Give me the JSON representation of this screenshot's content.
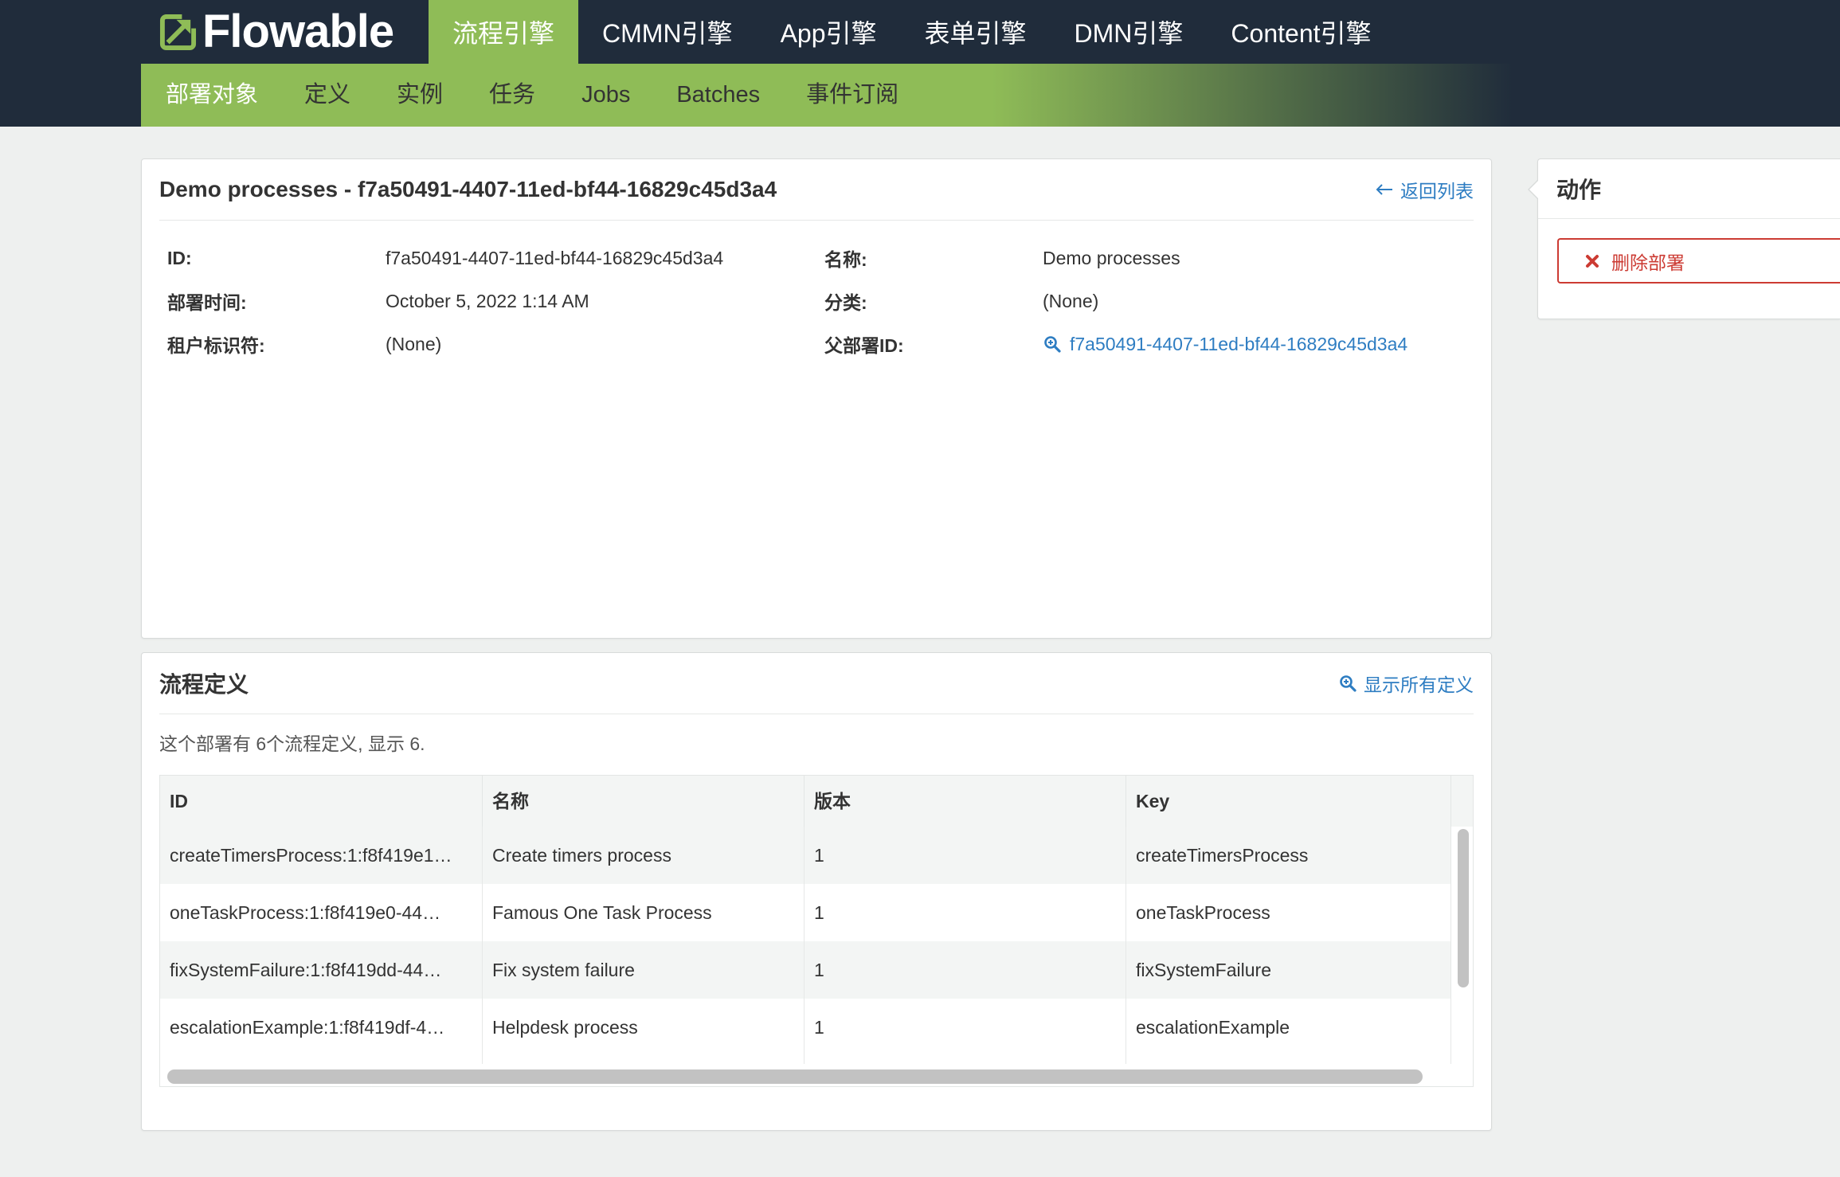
{
  "theme": {
    "nav_background": "#202c3b",
    "brand_green": "#8fbc57",
    "link_blue": "#2e7dc2",
    "danger_red": "#cc3b33",
    "page_background": "#eef0ef"
  },
  "app": {
    "logo_text": "Flowable",
    "logo_icon": "flowable-logo-icon"
  },
  "top_nav": {
    "tabs": [
      {
        "label": "流程引擎",
        "active": true
      },
      {
        "label": "CMMN引擎",
        "active": false
      },
      {
        "label": "App引擎",
        "active": false
      },
      {
        "label": "表单引擎",
        "active": false
      },
      {
        "label": "DMN引擎",
        "active": false
      },
      {
        "label": "Content引擎",
        "active": false
      }
    ]
  },
  "sub_nav": {
    "items": [
      {
        "label": "部署对象",
        "active": true
      },
      {
        "label": "定义",
        "active": false
      },
      {
        "label": "实例",
        "active": false
      },
      {
        "label": "任务",
        "active": false
      },
      {
        "label": "Jobs",
        "active": false
      },
      {
        "label": "Batches",
        "active": false
      },
      {
        "label": "事件订阅",
        "active": false
      }
    ]
  },
  "deployment": {
    "title": "Demo processes - f7a50491-4407-11ed-bf44-16829c45d3a4",
    "back_link": {
      "label": "返回列表",
      "icon": "arrow-left-icon"
    },
    "fields": {
      "id": {
        "label": "ID:",
        "value": "f7a50491-4407-11ed-bf44-16829c45d3a4"
      },
      "name": {
        "label": "名称:",
        "value": "Demo processes"
      },
      "deploy_time": {
        "label": "部署时间:",
        "value": "October 5, 2022 1:14 AM"
      },
      "category": {
        "label": "分类:",
        "value": "(None)"
      },
      "tenant_id": {
        "label": "租户标识符:",
        "value": "(None)"
      },
      "parent_deployment_id": {
        "label": "父部署ID:",
        "value": "f7a50491-4407-11ed-bf44-16829c45d3a4",
        "icon": "search-icon"
      }
    }
  },
  "process_definitions": {
    "title": "流程定义",
    "show_all_link": {
      "label": "显示所有定义",
      "icon": "search-icon"
    },
    "summary": "这个部署有 6个流程定义, 显示 6.",
    "columns": {
      "id": "ID",
      "name": "名称",
      "version": "版本",
      "key": "Key"
    },
    "rows": [
      {
        "id": "createTimersProcess:1:f8f419e1…",
        "name": "Create timers process",
        "version": "1",
        "key": "createTimersProcess"
      },
      {
        "id": "oneTaskProcess:1:f8f419e0-44…",
        "name": "Famous One Task Process",
        "version": "1",
        "key": "oneTaskProcess"
      },
      {
        "id": "fixSystemFailure:1:f8f419dd-44…",
        "name": "Fix system failure",
        "version": "1",
        "key": "fixSystemFailure"
      },
      {
        "id": "escalationExample:1:f8f419df-4…",
        "name": "Helpdesk process",
        "version": "1",
        "key": "escalationExample"
      }
    ]
  },
  "actions": {
    "title": "动作",
    "delete_button": {
      "label": "删除部署",
      "icon": "close-icon"
    }
  }
}
